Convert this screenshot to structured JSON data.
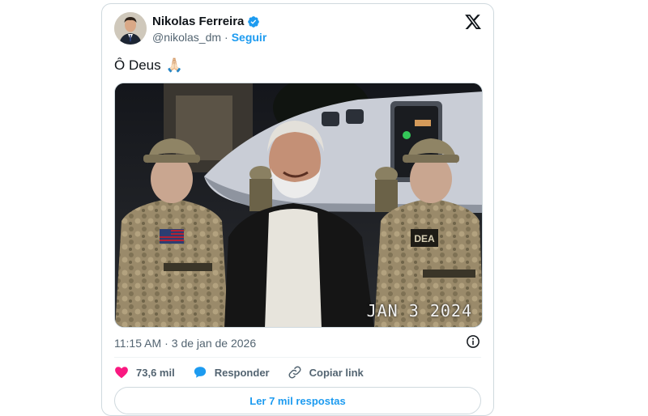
{
  "author": {
    "name": "Nikolas Ferreira",
    "handle": "@nikolas_dm",
    "follow_label": "Seguir",
    "verified": true
  },
  "tweet": {
    "text": "Ô Deus",
    "emoji": "🙏🏻",
    "media_alt": "",
    "media_stamp": "JAN  3 2024",
    "vest_patch": "DEA"
  },
  "meta": {
    "time": "11:15 AM",
    "separator": "·",
    "date": "3 de jan de 2026"
  },
  "actions": {
    "likes": "73,6 mil",
    "reply_label": "Responder",
    "copy_label": "Copiar link"
  },
  "replies_button": "Ler 7 mil respostas",
  "colors": {
    "accent": "#1d9bf0",
    "like": "#f91880",
    "text": "#0f1419",
    "muted": "#536471"
  }
}
